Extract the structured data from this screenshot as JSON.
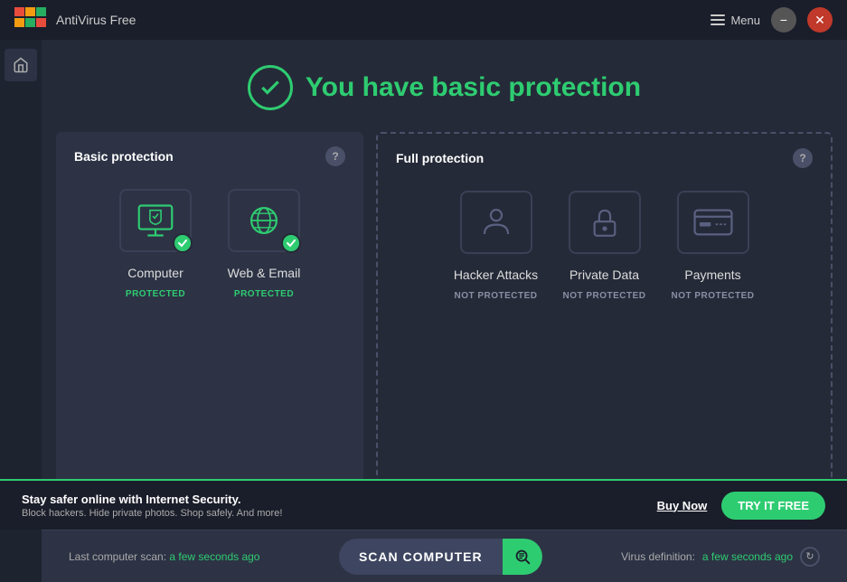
{
  "titleBar": {
    "logoAlt": "AVG Logo",
    "appTitle": "AntiVirus Free",
    "menuLabel": "Menu",
    "minimizeLabel": "−",
    "closeLabel": "✕"
  },
  "header": {
    "title": "You have basic protection"
  },
  "basicSection": {
    "title": "Basic protection",
    "helpLabel": "?",
    "items": [
      {
        "name": "Computer",
        "status": "PROTECTED",
        "statusType": "protected",
        "iconType": "computer"
      },
      {
        "name": "Web & Email",
        "status": "PROTECTED",
        "statusType": "protected",
        "iconType": "web"
      }
    ]
  },
  "fullSection": {
    "title": "Full protection",
    "helpLabel": "?",
    "items": [
      {
        "name": "Hacker Attacks",
        "status": "NOT PROTECTED",
        "statusType": "not-protected",
        "iconType": "hacker"
      },
      {
        "name": "Private Data",
        "status": "NOT PROTECTED",
        "statusType": "not-protected",
        "iconType": "lock"
      },
      {
        "name": "Payments",
        "status": "NOT PROTECTED",
        "statusType": "not-protected",
        "iconType": "card"
      }
    ]
  },
  "bottomBar": {
    "scanLabel": "Last computer scan:",
    "scanTime": "a few seconds ago",
    "scanButtonLabel": "SCAN COMPUTER",
    "virusLabel": "Virus definition:",
    "virusTime": "a few seconds ago"
  },
  "footerBanner": {
    "title": "Stay safer online with Internet Security.",
    "subtitle": "Block hackers. Hide private photos. Shop safely. And more!",
    "buyLabel": "Buy Now",
    "tryLabel": "TRY IT FREE"
  }
}
